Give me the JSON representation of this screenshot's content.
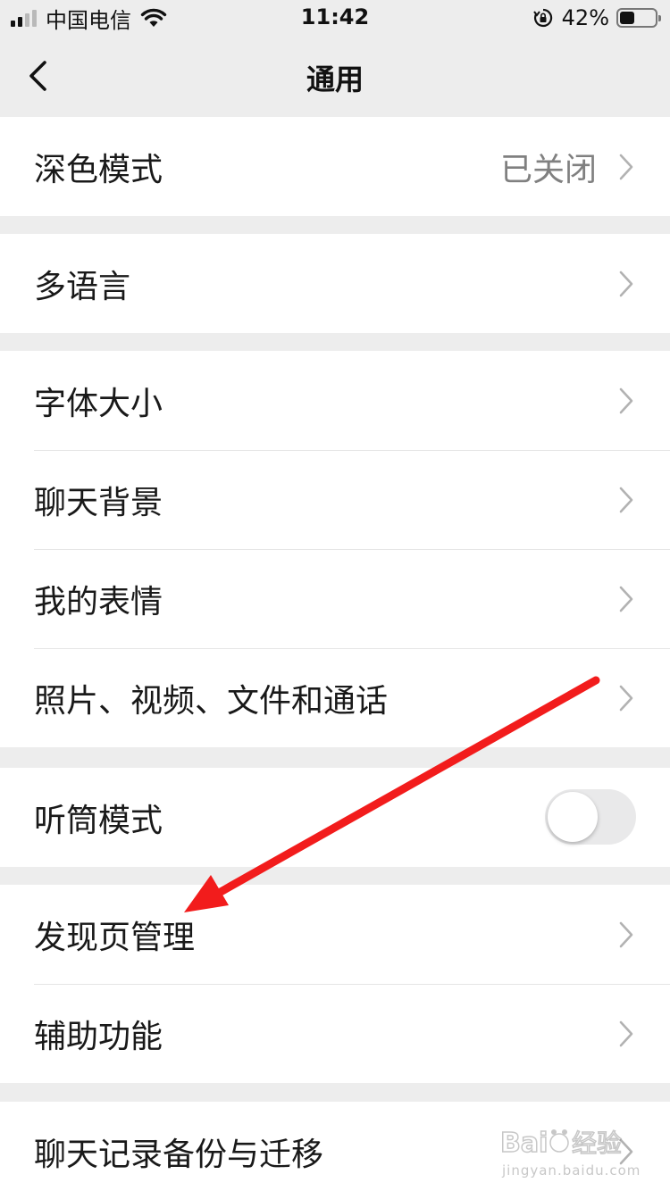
{
  "status_bar": {
    "carrier": "中国电信",
    "time": "11:42",
    "battery_percent": "42%",
    "battery_level": 0.42
  },
  "nav": {
    "title": "通用"
  },
  "groups": [
    {
      "items": [
        {
          "label": "深色模式",
          "value": "已关闭"
        }
      ]
    },
    {
      "items": [
        {
          "label": "多语言"
        }
      ]
    },
    {
      "items": [
        {
          "label": "字体大小"
        },
        {
          "label": "聊天背景"
        },
        {
          "label": "我的表情"
        },
        {
          "label": "照片、视频、文件和通话"
        }
      ]
    },
    {
      "items": [
        {
          "label": "听筒模式",
          "toggle": false
        }
      ]
    },
    {
      "items": [
        {
          "label": "发现页管理"
        },
        {
          "label": "辅助功能"
        }
      ]
    },
    {
      "items": [
        {
          "label": "聊天记录备份与迁移"
        }
      ]
    }
  ],
  "annotation": {
    "color": "#f21c1c",
    "points_to": "发现页管理"
  },
  "watermark": {
    "text": "jingyan.baidu.com"
  }
}
